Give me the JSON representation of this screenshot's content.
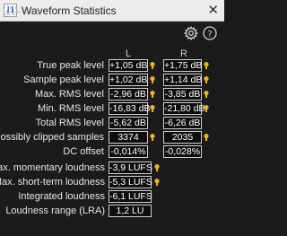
{
  "window": {
    "title": "Waveform Statistics",
    "close_glyph": "✕"
  },
  "toolbar": {
    "logo_icon": "waveform-logo-icon",
    "settings_icon": "gear-icon",
    "help_icon": "help-icon"
  },
  "columns": {
    "left": "L",
    "right": "R"
  },
  "channel_stats": [
    {
      "label": "True peak level",
      "left": "+1,05 dB",
      "right": "+1,75 dB",
      "left_warning": true,
      "right_warning": true
    },
    {
      "label": "Sample peak level",
      "left": "+1,02 dB",
      "right": "+1,14 dB",
      "left_warning": true,
      "right_warning": true
    },
    {
      "label": "Max. RMS level",
      "left": "-2,96 dB",
      "right": "-3,85 dB",
      "left_warning": true,
      "right_warning": true
    },
    {
      "label": "Min. RMS level",
      "left": "-16,83 dB",
      "right": "-21,80 dB",
      "left_warning": true,
      "right_warning": true
    },
    {
      "label": "Total RMS level",
      "left": "-5,62 dB",
      "right": "-6,26 dB",
      "left_warning": false,
      "right_warning": false
    },
    {
      "label": "Possibly clipped samples",
      "left": "3374",
      "right": "2035",
      "left_warning": true,
      "right_warning": true
    },
    {
      "label": "DC offset",
      "left": "-0,014%",
      "right": "-0,028%",
      "left_warning": false,
      "right_warning": false
    }
  ],
  "loudness_stats": [
    {
      "label": "Max. momentary loudness",
      "value": "-3,9 LUFS",
      "warning": true
    },
    {
      "label": "Max. short-term loudness",
      "value": "-5,3 LUFS",
      "warning": true
    },
    {
      "label": "Integrated loudness",
      "value": "-6,1 LUFS",
      "warning": false
    },
    {
      "label": "Loudness range (LRA)",
      "value": "1,2 LU",
      "warning": false
    }
  ],
  "colors": {
    "background": "#1b1b1b",
    "titlebar": "#ececec",
    "warning": "#f0b41c",
    "box_border": "#cfcfcf"
  }
}
